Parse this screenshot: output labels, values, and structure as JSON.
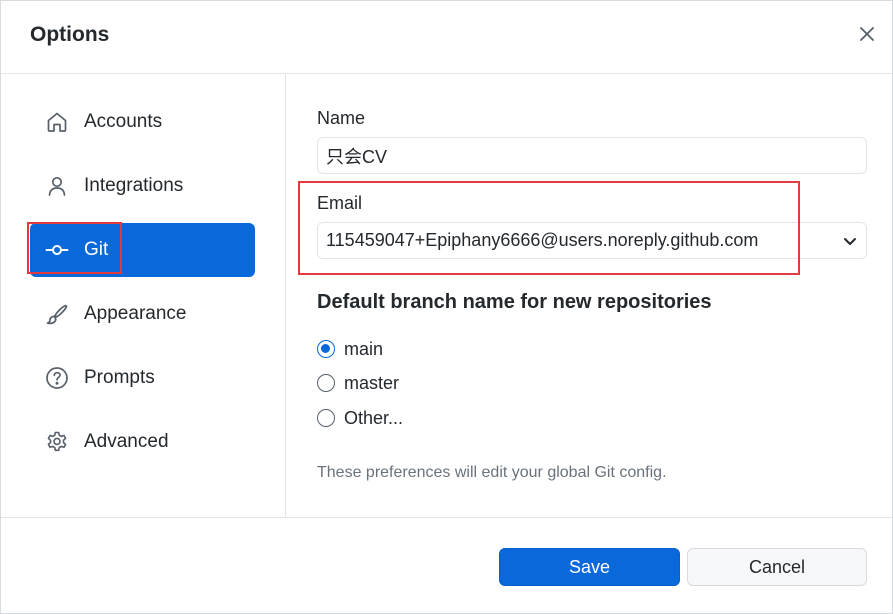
{
  "dialog": {
    "title": "Options",
    "close_icon": "close-icon"
  },
  "sidebar": {
    "items": [
      {
        "id": "accounts",
        "label": "Accounts",
        "icon": "home-icon",
        "active": false
      },
      {
        "id": "integrations",
        "label": "Integrations",
        "icon": "person-icon",
        "active": false
      },
      {
        "id": "git",
        "label": "Git",
        "icon": "git-commit-icon",
        "active": true
      },
      {
        "id": "appearance",
        "label": "Appearance",
        "icon": "paintbrush-icon",
        "active": false
      },
      {
        "id": "prompts",
        "label": "Prompts",
        "icon": "question-icon",
        "active": false
      },
      {
        "id": "advanced",
        "label": "Advanced",
        "icon": "gear-icon",
        "active": false
      }
    ]
  },
  "git": {
    "name_label": "Name",
    "name_value": "只会CV",
    "email_label": "Email",
    "email_value": "115459047+Epiphany6666@users.noreply.github.com",
    "branch_heading": "Default branch name for new repositories",
    "branch_options": [
      {
        "label": "main",
        "checked": true
      },
      {
        "label": "master",
        "checked": false
      },
      {
        "label": "Other...",
        "checked": false
      }
    ],
    "note": "These preferences will edit your global Git config."
  },
  "footer": {
    "save_label": "Save",
    "cancel_label": "Cancel"
  },
  "colors": {
    "accent": "#0969da",
    "annotation": "#e0393e"
  }
}
